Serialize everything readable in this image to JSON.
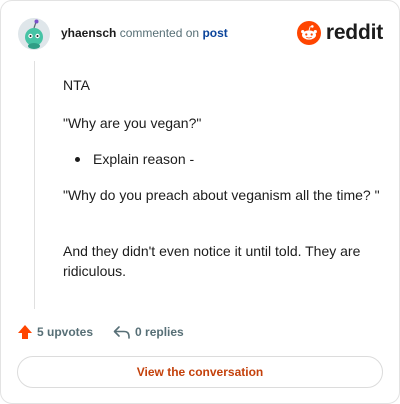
{
  "header": {
    "username": "yhaensch",
    "action_text": "commented on",
    "post_link": "post",
    "brand": "reddit"
  },
  "comment": {
    "line1": "NTA",
    "line2": "\"Why are you vegan?\"",
    "bullet": "Explain reason -",
    "line3": "\"Why do you preach about veganism all the time? \"",
    "line4": "And they didn't even notice it until told. They are ridiculous."
  },
  "actions": {
    "upvotes": "5 upvotes",
    "replies": "0 replies"
  },
  "cta": {
    "label": "View the conversation"
  },
  "colors": {
    "brand_orange": "#ff4500",
    "link_blue": "#0a449b",
    "cta_orange": "#c4410b",
    "avatar_teal": "#46c3a5"
  }
}
